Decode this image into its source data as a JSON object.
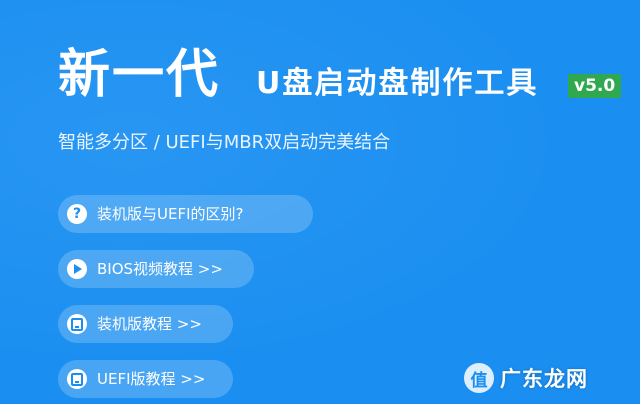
{
  "header": {
    "title_main": "新一代",
    "title_sub": "U盘启动盘制作工具",
    "version": "v5.0",
    "tagline": "智能多分区 / UEFI与MBR双启动完美结合"
  },
  "buttons": [
    {
      "label": "装机版与UEFI的区别?",
      "icon": "question-icon"
    },
    {
      "label": "BIOS视频教程 >>",
      "icon": "play-icon"
    },
    {
      "label": "装机版教程 >>",
      "icon": "document-icon"
    },
    {
      "label": "UEFI版教程 >>",
      "icon": "document-icon"
    }
  ],
  "watermark": {
    "logo_text": "值",
    "text": "广东龙网"
  },
  "colors": {
    "background": "#1b8ff1",
    "badge": "#2fa84f",
    "text": "#ffffff"
  }
}
